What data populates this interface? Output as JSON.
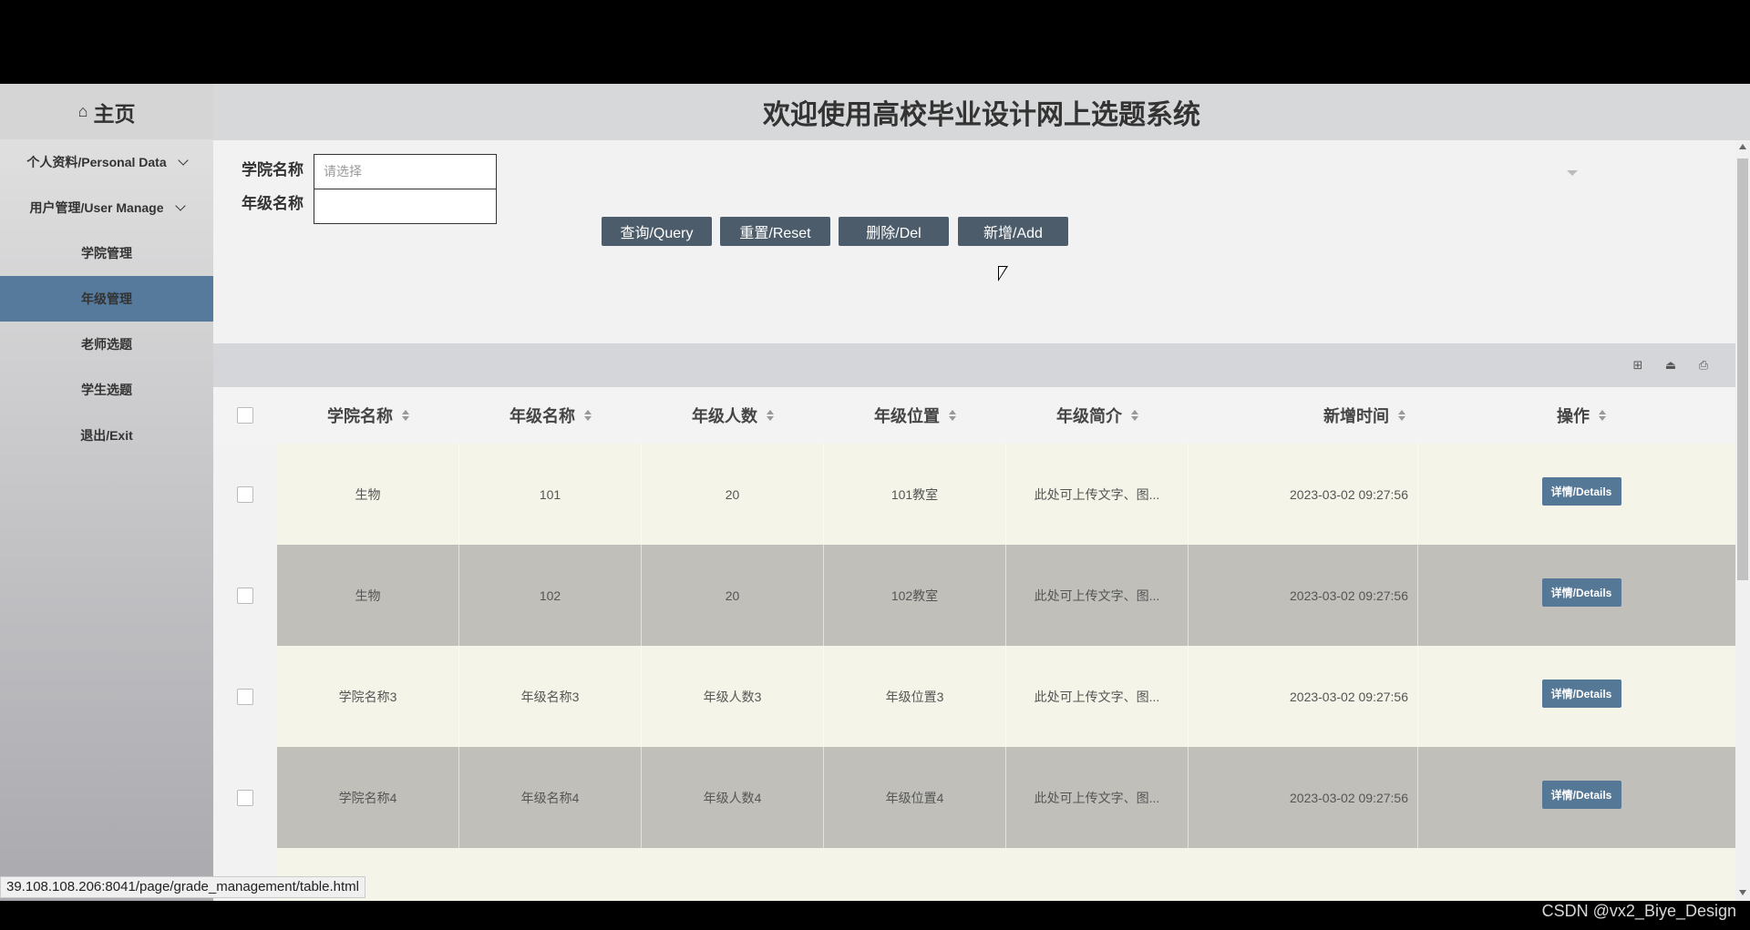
{
  "sidebar": {
    "home_label": "主页",
    "groups": [
      {
        "label": "个人资料/Personal Data"
      },
      {
        "label": "用户管理/User Manage"
      }
    ],
    "items": [
      {
        "label": "学院管理"
      },
      {
        "label": "年级管理",
        "active": true
      },
      {
        "label": "老师选题"
      },
      {
        "label": "学生选题"
      },
      {
        "label": "退出/Exit"
      }
    ]
  },
  "header": {
    "title": "欢迎使用高校毕业设计网上选题系统"
  },
  "search": {
    "college_label": "学院名称",
    "college_placeholder": "请选择",
    "grade_label": "年级名称",
    "grade_value": ""
  },
  "actions": {
    "query": "查询/Query",
    "reset": "重置/Reset",
    "delete": "删除/Del",
    "add": "新增/Add"
  },
  "table": {
    "columns": [
      "学院名称",
      "年级名称",
      "年级人数",
      "年级位置",
      "年级简介",
      "新增时间",
      "操作"
    ],
    "rows": [
      {
        "college": "生物",
        "grade": "101",
        "count": "20",
        "location": "101教室",
        "intro": "此处可上传文字、图...",
        "time": "2023-03-02 09:27:56",
        "action": "详情/Details"
      },
      {
        "college": "生物",
        "grade": "102",
        "count": "20",
        "location": "102教室",
        "intro": "此处可上传文字、图...",
        "time": "2023-03-02 09:27:56",
        "action": "详情/Details"
      },
      {
        "college": "学院名称3",
        "grade": "年级名称3",
        "count": "年级人数3",
        "location": "年级位置3",
        "intro": "此处可上传文字、图...",
        "time": "2023-03-02 09:27:56",
        "action": "详情/Details"
      },
      {
        "college": "学院名称4",
        "grade": "年级名称4",
        "count": "年级人数4",
        "location": "年级位置4",
        "intro": "此处可上传文字、图...",
        "time": "2023-03-02 09:27:56",
        "action": "详情/Details"
      }
    ]
  },
  "status_url": "39.108.108.206:8041/page/grade_management/table.html",
  "watermark": "CSDN @vx2_Biye_Design"
}
